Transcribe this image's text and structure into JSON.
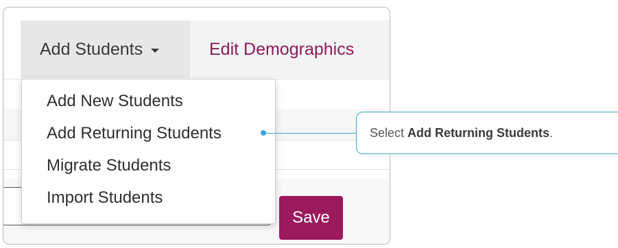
{
  "toolbar": {
    "add_students_label": "Add Students",
    "edit_demographics_label": "Edit Demographics"
  },
  "menu": {
    "items": [
      {
        "label": "Add New Students"
      },
      {
        "label": "Add Returning Students"
      },
      {
        "label": "Migrate Students"
      },
      {
        "label": "Import Students"
      }
    ]
  },
  "form": {
    "save_label": "Save"
  },
  "callout": {
    "prefix": "Select ",
    "emphasis": "Add Returning Students",
    "suffix": "."
  },
  "colors": {
    "accent": "#8c1a5c",
    "save_button": "#9a1a5d",
    "callout": "#3ba7d6"
  }
}
